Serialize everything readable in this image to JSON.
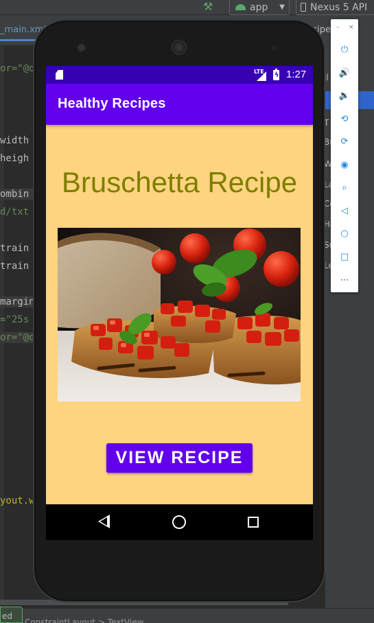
{
  "ide": {
    "run_config": "app",
    "device": "Nexus 5 API",
    "editor_tab": "_main.xml",
    "right_tab": "cipe",
    "code_lines": [
      {
        "a": "or=\"@dr",
        "b": ""
      },
      {
        "a": "width",
        "b": ""
      },
      {
        "a": "heigh",
        "b": ""
      },
      {
        "a": "ombin",
        "b": ""
      },
      {
        "a": "d/txt",
        "b": ""
      },
      {
        "a": "train",
        "b": ""
      },
      {
        "a": "train",
        "b": ""
      },
      {
        "a": "margin",
        "b": ""
      },
      {
        "a": "=\"25s",
        "b": ""
      },
      {
        "a": "or=\"@dr",
        "b": ""
      },
      {
        "a": "yout.w",
        "b": ""
      }
    ],
    "right_panel": [
      "il",
      "n",
      "T",
      "Bu",
      "W",
      "La",
      "Co",
      "He",
      "Su",
      "Le"
    ],
    "right_panel_selected": "n",
    "right_panel_extra": "ers",
    "bottom_left": "ed",
    "breadcrumbs": "ConstraintLayout  >  TextView"
  },
  "device": {
    "status_bar": {
      "network": "LTE",
      "time": "1:27"
    },
    "app": {
      "title": "Healthy Recipes",
      "recipe_title": "Bruschetta Recipe",
      "image_alt": "bruschetta",
      "button_label": "VIEW RECIPE"
    },
    "nav": {
      "back": "back-icon",
      "home": "home-icon",
      "recents": "recents-icon"
    },
    "colors": {
      "status_bar": "#3700b3",
      "app_bar": "#6200ee",
      "background": "#ffd480",
      "recipe_title": "#7e7e00",
      "button": "#6200ee"
    }
  },
  "emulator_toolbar": {
    "minimize": "–",
    "close": "×",
    "buttons": [
      "power-icon",
      "volume-up-icon",
      "volume-down-icon",
      "rotate-left-icon",
      "rotate-right-icon",
      "camera-icon",
      "zoom-icon",
      "back-icon",
      "home-icon",
      "overview-icon",
      "more-icon"
    ]
  }
}
